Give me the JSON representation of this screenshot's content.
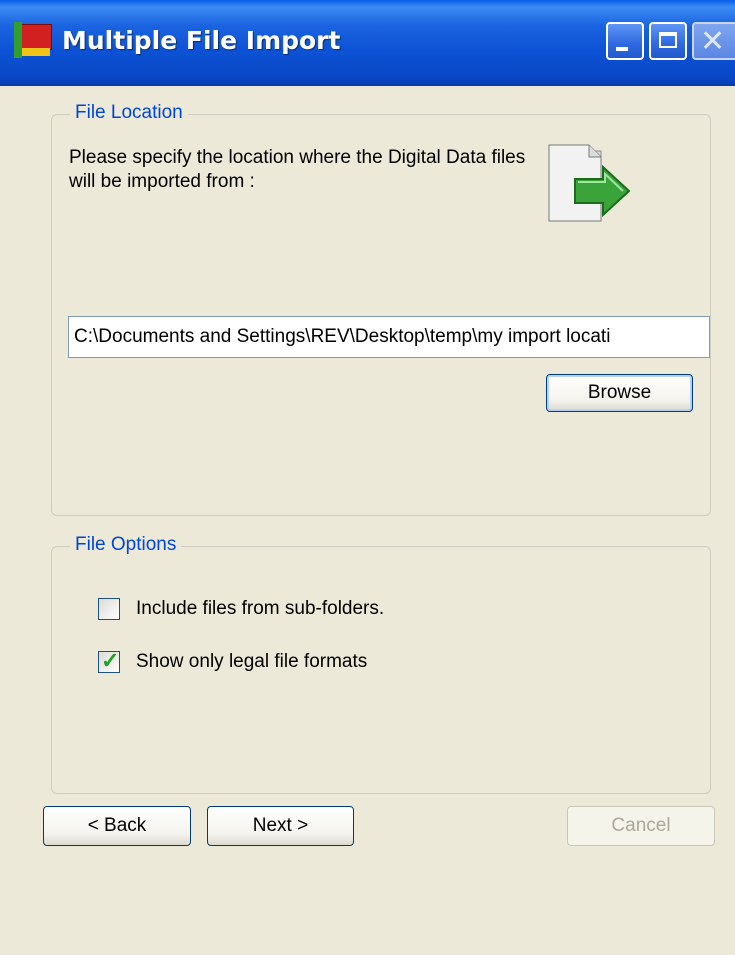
{
  "window": {
    "title": "Multiple File Import"
  },
  "title_buttons": {
    "minimize_icon": "minimize-icon",
    "maximize_icon": "maximize-icon",
    "close_icon": "close-icon"
  },
  "file_location": {
    "legend": "File Location",
    "instruction": "Please specify the location where the Digital Data files will be imported from :",
    "path_value": "C:\\Documents and Settings\\REV\\Desktop\\temp\\my import locati",
    "browse_label": "Browse"
  },
  "file_options": {
    "legend": "File Options",
    "options": [
      {
        "label": "Include files from sub-folders.",
        "checked": false
      },
      {
        "label": "Show only legal file formats",
        "checked": true
      }
    ]
  },
  "footer": {
    "back_label": "< Back",
    "next_label": "Next >",
    "cancel_label": "Cancel"
  },
  "colors": {
    "title_bar": "#0a54d8",
    "group_legend": "#0046d5",
    "check_mark": "#21a121"
  }
}
